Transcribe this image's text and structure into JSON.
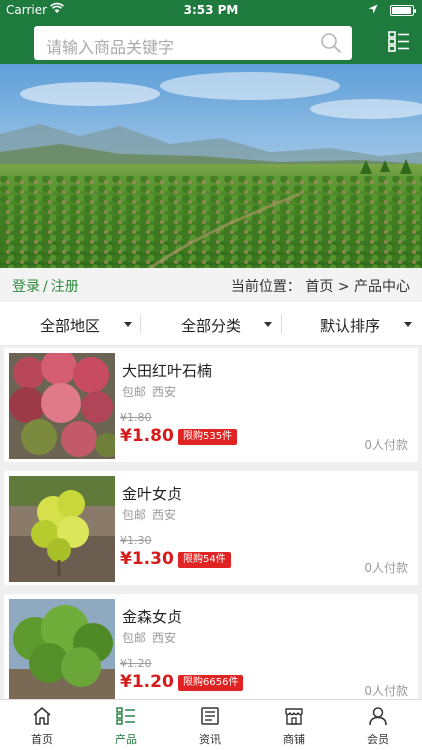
{
  "status_bar": {
    "carrier": "Carrier",
    "time": "3:53 PM"
  },
  "search": {
    "placeholder": "请输入商品关键字"
  },
  "icons": {
    "search": "search-icon",
    "menu": "list-menu-icon"
  },
  "colors": {
    "brand_green": "#1f7a3d",
    "price_red": "#d71a1a",
    "badge_red": "#e02424",
    "link_green": "#2e8b3e"
  },
  "auth": {
    "login": "登录",
    "separator": "/",
    "register": "注册"
  },
  "breadcrumb": {
    "prefix": "当前位置：",
    "home": "首页",
    "arrow": ">",
    "current": "产品中心"
  },
  "filters": [
    {
      "label": "全部地区"
    },
    {
      "label": "全部分类"
    },
    {
      "label": "默认排序"
    }
  ],
  "products": [
    {
      "name": "大田红叶石楠",
      "shipping": "包邮",
      "location": "西安",
      "old_price": "¥1.80",
      "price": "¥1.80",
      "limit": "限购535件",
      "paid": "0人付款"
    },
    {
      "name": "金叶女贞",
      "shipping": "包邮",
      "location": "西安",
      "old_price": "¥1.30",
      "price": "¥1.30",
      "limit": "限购54件",
      "paid": "0人付款"
    },
    {
      "name": "金森女贞",
      "shipping": "包邮",
      "location": "西安",
      "old_price": "¥1.20",
      "price": "¥1.20",
      "limit": "限购6656件",
      "paid": "0人付款"
    }
  ],
  "tabs": [
    {
      "label": "首页",
      "icon": "home-icon",
      "active": false
    },
    {
      "label": "产品",
      "icon": "product-list-icon",
      "active": true
    },
    {
      "label": "资讯",
      "icon": "news-icon",
      "active": false
    },
    {
      "label": "商铺",
      "icon": "store-icon",
      "active": false
    },
    {
      "label": "会员",
      "icon": "member-icon",
      "active": false
    }
  ]
}
